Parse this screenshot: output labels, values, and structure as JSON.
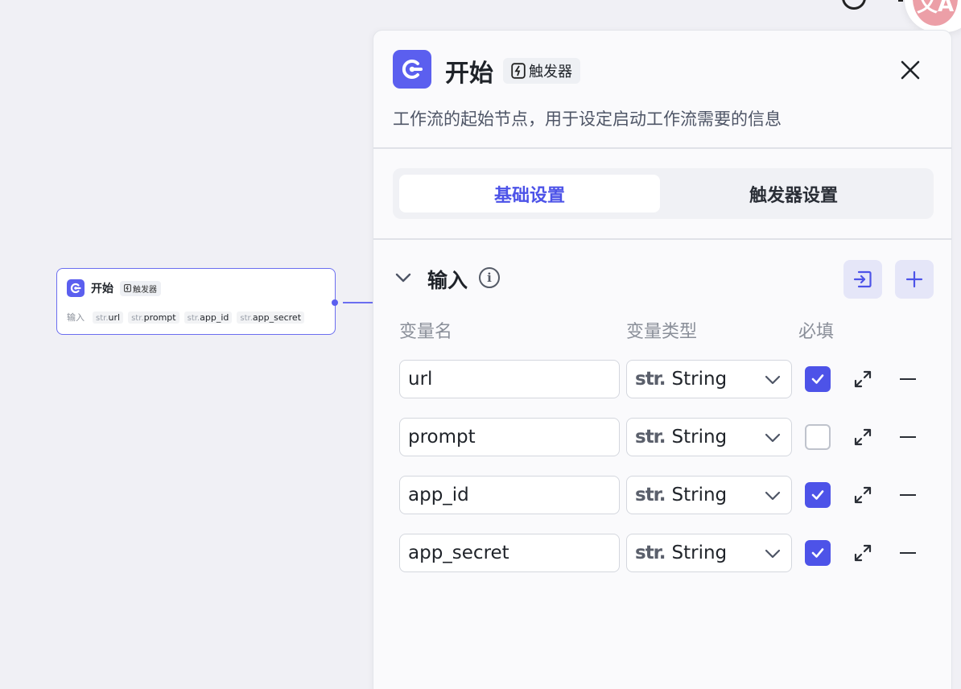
{
  "canvas_node": {
    "title": "开始",
    "badge": "触发器",
    "inputs_label": "输入",
    "inputs": [
      {
        "type": "str.",
        "name": "url"
      },
      {
        "type": "str.",
        "name": "prompt"
      },
      {
        "type": "str.",
        "name": "app_id"
      },
      {
        "type": "str.",
        "name": "app_secret"
      }
    ]
  },
  "translate_button": {
    "label": "文A"
  },
  "panel": {
    "title": "开始",
    "badge": "触发器",
    "description": "工作流的起始节点，用于设定启动工作流需要的信息",
    "tabs": [
      {
        "label": "基础设置",
        "active": true
      },
      {
        "label": "触发器设置",
        "active": false
      }
    ],
    "section": {
      "title": "输入",
      "info_icon": "i"
    },
    "columns": {
      "name": "变量名",
      "type": "变量类型",
      "required": "必填"
    },
    "variables": [
      {
        "name": "url",
        "type_prefix": "str.",
        "type": "String",
        "required": true
      },
      {
        "name": "prompt",
        "type_prefix": "str.",
        "type": "String",
        "required": false
      },
      {
        "name": "app_id",
        "type_prefix": "str.",
        "type": "String",
        "required": true
      },
      {
        "name": "app_secret",
        "type_prefix": "str.",
        "type": "String",
        "required": true
      }
    ]
  },
  "colors": {
    "accent": "#4d53e8",
    "logo": "#5b5fef",
    "canvas_bg": "#f0f0f5"
  }
}
